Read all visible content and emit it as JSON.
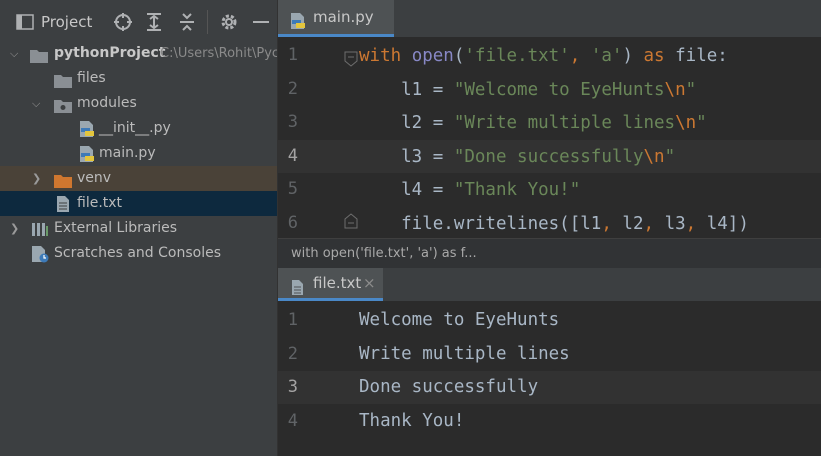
{
  "project_panel": {
    "title": "Project",
    "toolbar_icons": [
      "crosshair-icon",
      "expand-all-icon",
      "collapse-all-icon",
      "gear-icon",
      "minimize-icon"
    ],
    "tree": [
      {
        "label": "pythonProject",
        "path": "C:\\Users\\Rohit\\Pyc",
        "type": "folder",
        "expanded": true
      },
      {
        "label": "files",
        "type": "folder"
      },
      {
        "label": "modules",
        "type": "package",
        "expanded": true
      },
      {
        "label": "__init__.py",
        "type": "python-file"
      },
      {
        "label": "main.py",
        "type": "python-file"
      },
      {
        "label": "venv",
        "type": "excluded-folder",
        "expanded": false
      },
      {
        "label": "file.txt",
        "type": "text-file",
        "selected": true
      },
      {
        "label": "External Libraries",
        "type": "libraries",
        "expanded": false
      },
      {
        "label": "Scratches and Consoles",
        "type": "scratches"
      }
    ]
  },
  "editor_top": {
    "tab_label": "main.py",
    "line_numbers": [
      "1",
      "2",
      "3",
      "4",
      "5",
      "6"
    ],
    "current_line": "4",
    "lines": [
      [
        {
          "t": "with ",
          "c": "kw"
        },
        {
          "t": "open",
          "c": "fn"
        },
        {
          "t": "(",
          "c": "punct"
        },
        {
          "t": "'file.txt'",
          "c": "str"
        },
        {
          "t": ", ",
          "c": "kw"
        },
        {
          "t": "'a'",
          "c": "str"
        },
        {
          "t": ") ",
          "c": "punct"
        },
        {
          "t": "as ",
          "c": "kw"
        },
        {
          "t": "file:",
          "c": "var"
        }
      ],
      [
        {
          "t": "    l1 = ",
          "c": "var"
        },
        {
          "t": "\"Welcome to EyeHunts",
          "c": "str"
        },
        {
          "t": "\\n",
          "c": "esc"
        },
        {
          "t": "\"",
          "c": "str"
        }
      ],
      [
        {
          "t": "    l2 = ",
          "c": "var"
        },
        {
          "t": "\"Write multiple lines",
          "c": "str"
        },
        {
          "t": "\\n",
          "c": "esc"
        },
        {
          "t": "\"",
          "c": "str"
        }
      ],
      [
        {
          "t": "    l3 = ",
          "c": "var"
        },
        {
          "t": "\"Done successfully",
          "c": "str"
        },
        {
          "t": "\\n",
          "c": "esc"
        },
        {
          "t": "\"",
          "c": "str"
        }
      ],
      [
        {
          "t": "    l4 = ",
          "c": "var"
        },
        {
          "t": "\"Thank You!\"",
          "c": "str"
        }
      ],
      [
        {
          "t": "    file.writelines([l1",
          "c": "var"
        },
        {
          "t": ", ",
          "c": "kw"
        },
        {
          "t": "l2",
          "c": "var"
        },
        {
          "t": ", ",
          "c": "kw"
        },
        {
          "t": "l3",
          "c": "var"
        },
        {
          "t": ", ",
          "c": "kw"
        },
        {
          "t": "l4])",
          "c": "var"
        }
      ]
    ],
    "breadcrumb": "with open('file.txt', 'a') as f..."
  },
  "editor_bottom": {
    "tab_label": "file.txt",
    "close_glyph": "×",
    "line_numbers": [
      "1",
      "2",
      "3",
      "4"
    ],
    "current_line": "3",
    "lines": [
      "Welcome to EyeHunts",
      "Write multiple lines",
      "Done successfully",
      "Thank You!"
    ]
  },
  "colors": {
    "panel_bg": "#3c3f41",
    "editor_bg": "#2b2b2b",
    "selection": "#0d293e",
    "keyword": "#cc7832",
    "string": "#6a8759",
    "builtin": "#8888c6",
    "tab_underline": "#4a88c7"
  }
}
